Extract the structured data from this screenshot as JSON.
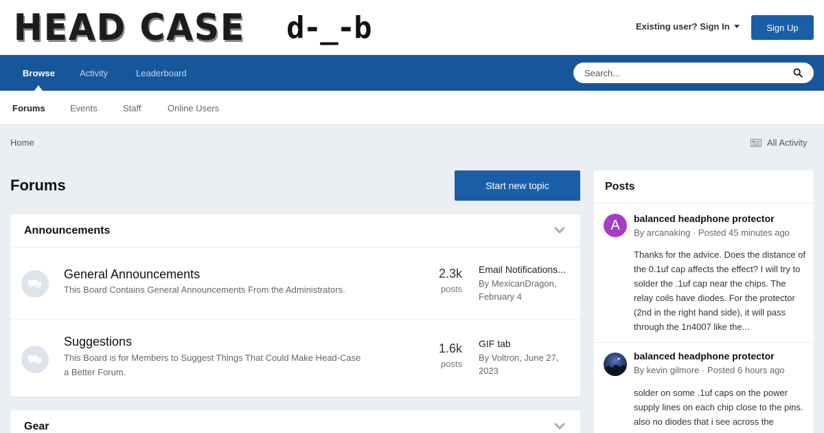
{
  "header": {
    "logo_text": "HEAD CASE",
    "logo_face": "d-_-b",
    "signin_label": "Existing user? Sign In",
    "signup_label": "Sign Up"
  },
  "nav_primary": [
    {
      "label": "Browse",
      "active": true
    },
    {
      "label": "Activity",
      "active": false
    },
    {
      "label": "Leaderboard",
      "active": false
    }
  ],
  "search": {
    "placeholder": "Search..."
  },
  "nav_secondary": [
    {
      "label": "Forums",
      "active": true
    },
    {
      "label": "Events",
      "active": false
    },
    {
      "label": "Staff",
      "active": false
    },
    {
      "label": "Online Users",
      "active": false
    }
  ],
  "breadcrumb": {
    "home": "Home",
    "all_activity": "All Activity"
  },
  "page": {
    "title": "Forums",
    "start_topic_label": "Start new topic"
  },
  "categories": [
    {
      "name": "Announcements",
      "forums": [
        {
          "title": "General Announcements",
          "desc_1": "This Board Contains General Announcements From the Administrators.",
          "desc_2": "",
          "count": "2.3k",
          "count_label": "posts",
          "last_title": "Email Notifications...",
          "last_by_1": "By MexicanDragon,",
          "last_by_2": "February 4"
        },
        {
          "title": "Suggestions",
          "desc_1": "This Board is for Members to Suggest Things That Could Make Head-Case",
          "desc_2": "a Better Forum.",
          "count": "1.6k",
          "count_label": "posts",
          "last_title": "GIF tab",
          "last_by_1": "By Voltron, June 27,",
          "last_by_2": "2023"
        }
      ]
    },
    {
      "name": "Gear",
      "forums": []
    }
  ],
  "sidebar": {
    "title": "Posts",
    "posts": [
      {
        "avatar_letter": "A",
        "title": "balanced headphone protector",
        "meta": "By arcanaking · Posted 45 minutes ago",
        "body": "Thanks for the advice. Does the distance of the 0.1uf cap affects the effect? I will try to solder the .1uf cap near the chips. The relay coils have diodes. For the protector (2nd in the right hand side), it will pass through the 1n4007 like the..."
      },
      {
        "avatar_letter": "",
        "title": "balanced headphone protector",
        "meta": "By kevin gilmore · Posted 6 hours ago",
        "body": "solder on some .1uf caps on the power supply lines on each chip close to the pins. also no diodes that i see across the"
      }
    ]
  },
  "colors": {
    "brand": "#16569b",
    "button": "#1a5ea8",
    "avatar_a": "#a43ec6"
  }
}
